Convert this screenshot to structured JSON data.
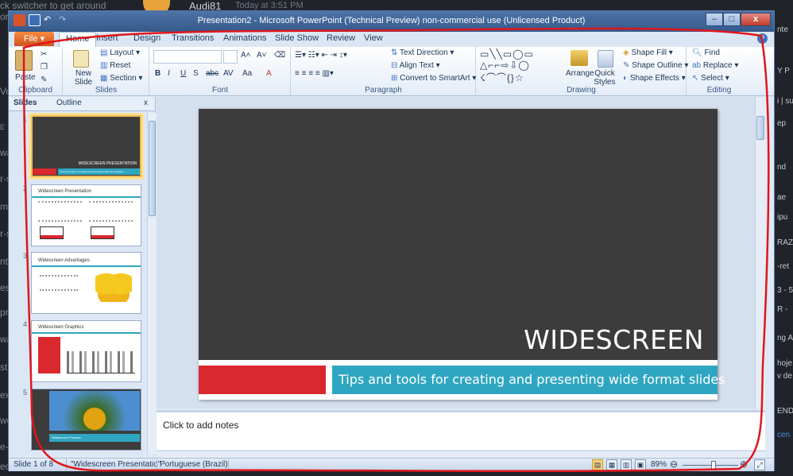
{
  "background": {
    "chat_lines": [
      "ck switcher to get around",
      "ord",
      "Vo",
      "E",
      "wa",
      "r-s",
      "m-",
      "r-s",
      "nt",
      "es",
      "pro",
      "wa",
      "st",
      "ext",
      "wo",
      "e-c",
      "ecn"
    ],
    "sender_name": "Audi81",
    "sender_time": "Today at 3:51 PM",
    "right_snippets": [
      "nte",
      "Y P",
      "i | sur",
      "ep",
      "nd",
      "ae",
      "ipu",
      "RAZ",
      "-ret",
      "3 - 5",
      "R -",
      "ng A",
      "hoje",
      "v de",
      "END",
      "cen"
    ]
  },
  "window": {
    "title": "Presentation2 - Microsoft PowerPoint (Technical Preview) non-commercial use (Unlicensed Product)",
    "controls": {
      "minimize": "–",
      "maximize": "□",
      "close": "x"
    }
  },
  "ribbon_tabs": {
    "file": "File",
    "items": [
      "Home",
      "Insert",
      "Design",
      "Transitions",
      "Animations",
      "Slide Show",
      "Review",
      "View"
    ],
    "active": "Home",
    "help": "?"
  },
  "ribbon": {
    "clipboard": {
      "label": "Clipboard",
      "paste": "Paste"
    },
    "slides": {
      "label": "Slides",
      "new_slide": "New Slide",
      "layout": "Layout",
      "reset": "Reset",
      "section": "Section"
    },
    "font": {
      "label": "Font",
      "bold": "B",
      "italic": "I",
      "underline": "U",
      "strike": "abc",
      "spacing": "AV",
      "case": "Aa",
      "grow": "A˄",
      "shrink": "A˅",
      "color": "A"
    },
    "paragraph": {
      "label": "Paragraph",
      "text_direction": "Text Direction",
      "align_text": "Align Text",
      "convert": "Convert to SmartArt"
    },
    "drawing": {
      "label": "Drawing",
      "arrange": "Arrange",
      "quick_styles": "Quick Styles",
      "shape_fill": "Shape Fill",
      "shape_outline": "Shape Outline",
      "shape_effects": "Shape Effects"
    },
    "editing": {
      "label": "Editing",
      "find": "Find",
      "replace": "Replace",
      "select": "Select"
    }
  },
  "left_pane": {
    "tabs": [
      "Slides",
      "Outline"
    ],
    "close": "x",
    "thumbnails": [
      {
        "num": "1",
        "title": "WIDESCREEN PRESENTATION",
        "subtitle": "Tips and tools for creating and presenting wide format slides"
      },
      {
        "num": "2",
        "title": "Widescreen Presentation"
      },
      {
        "num": "3",
        "title": "Widescreen Advantages"
      },
      {
        "num": "4",
        "title": "Widescreen Graphics"
      },
      {
        "num": "5",
        "title": "Widescreen Pictures"
      }
    ]
  },
  "slide": {
    "title": "WIDESCREEN PRESENTATION",
    "subtitle": "Tips and tools for creating and presenting wide format slides"
  },
  "notes": {
    "placeholder": "Click to add notes"
  },
  "status_bar": {
    "slide_indicator": "Slide 1 of 8",
    "theme": "\"Widescreen Presentatio\"",
    "language": "Portuguese (Brazil)",
    "zoom": "89%",
    "zoom_fraction": 0.55
  },
  "colors": {
    "slide_bg": "#3c3c3c",
    "slide_accent_red": "#d9282e",
    "slide_accent_blue": "#2fa6c1",
    "annotation": "#e0161b"
  }
}
